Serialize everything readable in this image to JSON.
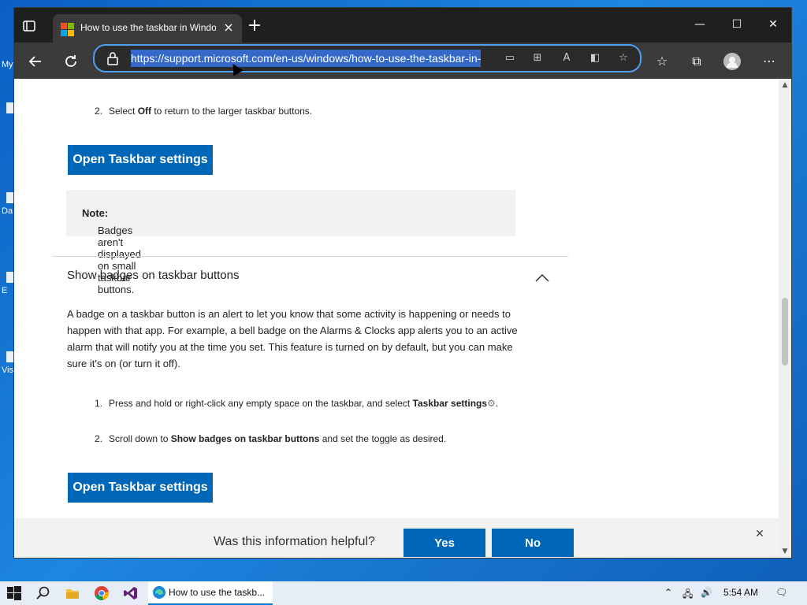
{
  "desktop": {
    "icons": [
      {
        "label": "My"
      },
      {
        "label": ""
      },
      {
        "label": "Da"
      },
      {
        "label": "E"
      },
      {
        "label": "Vis"
      }
    ]
  },
  "browser": {
    "tab": {
      "title": "How to use the taskbar in Windows",
      "close": "×"
    },
    "new_tab": "+",
    "window_controls": {
      "minimize": "—",
      "maximize": "☐",
      "close": "✕"
    },
    "address": {
      "url": "https://support.microsoft.com/en-us/windows/how-to-use-the-taskbar-in-"
    },
    "icons": [
      "back-icon",
      "refresh-icon",
      "lock-icon",
      "reader-icon",
      "apps-icon",
      "read-aloud-icon",
      "immersive-icon",
      "favorite-add-icon",
      "favorites-icon",
      "collections-icon",
      "profile-icon",
      "more-icon"
    ]
  },
  "article": {
    "step_off": {
      "num": "2.",
      "pre": "Select ",
      "bold": "Off",
      "post": " to return to the larger taskbar buttons."
    },
    "open_settings_1": "Open Taskbar settings",
    "note": {
      "bold": "Note:",
      "text": " Badges aren't displayed on small taskbar buttons."
    },
    "section_title": "Show badges on taskbar buttons",
    "paragraph": "A badge on a taskbar button is an alert to let you know that some activity is happening or needs to happen with that app. For example, a bell badge on the Alarms & Clocks app alerts you to an active alarm that will notify you at the time you set. This feature is turned on by default, but you can make sure it's on (or turn it off).",
    "step1": {
      "num": "1.",
      "pre": "Press and hold or right-click any empty space on the taskbar, and select ",
      "bold": "Taskbar settings",
      "post": "."
    },
    "step2": {
      "num": "2.",
      "pre": "Scroll down to ",
      "bold": "Show badges on taskbar buttons",
      "post": " and set the toggle as desired."
    },
    "open_settings_2": "Open Taskbar settings"
  },
  "feedback": {
    "question": "Was this information helpful?",
    "yes": "Yes",
    "no": "No",
    "close": "✕"
  },
  "taskbar": {
    "active_task": "How to use the taskb...",
    "time": "5:54 AM",
    "icons": [
      "start-icon",
      "search-icon",
      "file-explorer-icon",
      "chrome-icon",
      "visual-studio-icon",
      "edge-icon"
    ]
  },
  "colors": {
    "accent": "#0067b8",
    "url_highlight": "#3469c9",
    "browser_chrome": "#3b3b3b"
  }
}
